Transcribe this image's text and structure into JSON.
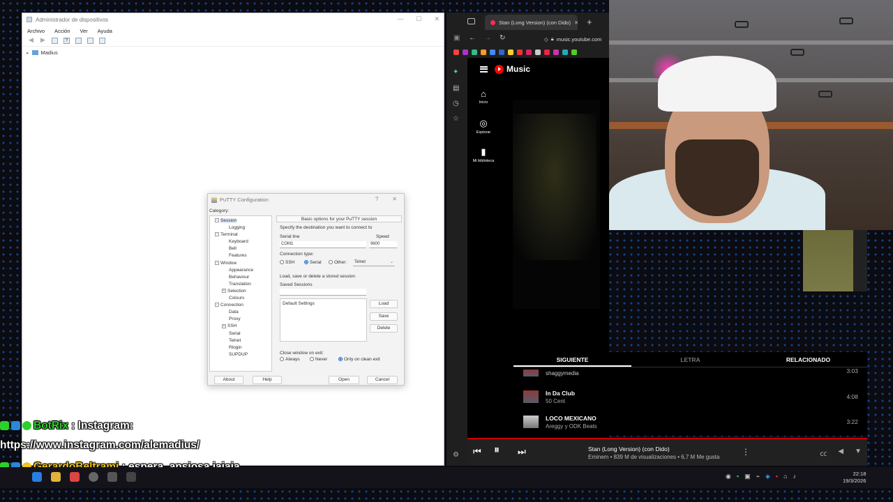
{
  "device_manager": {
    "title": "Administrador de dispositivos",
    "menu": [
      "Archivo",
      "Acción",
      "Ver",
      "Ayuda"
    ],
    "tree_root": "Madius"
  },
  "putty": {
    "title": "PuTTY Configuration",
    "help_glyph": "?",
    "close_glyph": "✕",
    "category_label": "Category:",
    "categories": [
      {
        "label": "Session",
        "level": 1,
        "expander": "⊟",
        "selected": true
      },
      {
        "label": "Logging",
        "level": 2
      },
      {
        "label": "Terminal",
        "level": 1,
        "expander": "⊟"
      },
      {
        "label": "Keyboard",
        "level": 2
      },
      {
        "label": "Bell",
        "level": 2
      },
      {
        "label": "Features",
        "level": 2
      },
      {
        "label": "Window",
        "level": 1,
        "expander": "⊟"
      },
      {
        "label": "Appearance",
        "level": 2
      },
      {
        "label": "Behaviour",
        "level": 2
      },
      {
        "label": "Translation",
        "level": 2
      },
      {
        "label": "Selection",
        "level": 2,
        "expander": "⊞"
      },
      {
        "label": "Colours",
        "level": 2
      },
      {
        "label": "Connection",
        "level": 1,
        "expander": "⊟"
      },
      {
        "label": "Data",
        "level": 2
      },
      {
        "label": "Proxy",
        "level": 2
      },
      {
        "label": "SSH",
        "level": 2,
        "expander": "⊞"
      },
      {
        "label": "Serial",
        "level": 2
      },
      {
        "label": "Telnet",
        "level": 2
      },
      {
        "label": "Rlogin",
        "level": 2
      },
      {
        "label": "SUPDUP",
        "level": 2
      }
    ],
    "header": "Basic options for your PuTTY session",
    "dest_label": "Specify the destination you want to connect to",
    "serial_line_label": "Serial line",
    "serial_line_value": "COM1",
    "speed_label": "Speed",
    "speed_value": "9600",
    "conn_type_label": "Connection type:",
    "conn_types": [
      "SSH",
      "Serial",
      "Other:"
    ],
    "other_value": "Telnet",
    "load_save_label": "Load, save or delete a stored session",
    "saved_sessions_label": "Saved Sessions",
    "saved_sessions_value": "",
    "sessions": [
      "Default Settings"
    ],
    "load_btn": "Load",
    "save_btn": "Save",
    "delete_btn": "Delete",
    "close_exit_label": "Close window on exit:",
    "close_options": [
      "Always",
      "Never",
      "Only on clean exit"
    ],
    "about_btn": "About",
    "help_btn": "Help",
    "open_btn": "Open",
    "cancel_btn": "Cancel"
  },
  "browser": {
    "tab_title": "Stan (Long Version) (con Dido)",
    "url": "music.youtube.com",
    "ytmusic": {
      "brand": "Music",
      "nav": [
        {
          "label": "Inicio",
          "icon": "home-icon",
          "glyph": "⌂"
        },
        {
          "label": "Explorar",
          "icon": "compass-icon",
          "glyph": "◎"
        },
        {
          "label": "Mi biblioteca",
          "icon": "library-icon",
          "glyph": "▮"
        }
      ],
      "queue_tabs": [
        "SIGUIENTE",
        "LETRA",
        "RELACIONADO"
      ],
      "queue": [
        {
          "title": "",
          "artist": "shaggymedia",
          "duration": "3:03"
        },
        {
          "title": "In Da Club",
          "artist": "50 Cent",
          "duration": "4:08"
        },
        {
          "title": "LOCO MEXICANO",
          "artist": "Areggy y ODK Beats",
          "duration": "3:22"
        }
      ],
      "now_playing": {
        "title": "Stan (Long Version) (con Dido)",
        "subtitle": "Eminem • 839 M de visualizaciones • 6,7 M Me gusta"
      }
    }
  },
  "chat": [
    {
      "user": "BotRix",
      "text": " : Instagram:",
      "user_color": "#2bd12b"
    },
    {
      "user": "",
      "text": "https://www.instagram.com/alemadius/",
      "user_color": "#ffffff"
    },
    {
      "user": "GerardoBeltrami",
      "text": " : espera, ansiosa jajaja",
      "user_color": "#f0c419"
    }
  ],
  "taskbar": {
    "time": "22:18",
    "date": "19/3/2026"
  },
  "colors": {
    "ytm_red": "#ff0000",
    "accent_blue": "#1a64c8"
  }
}
